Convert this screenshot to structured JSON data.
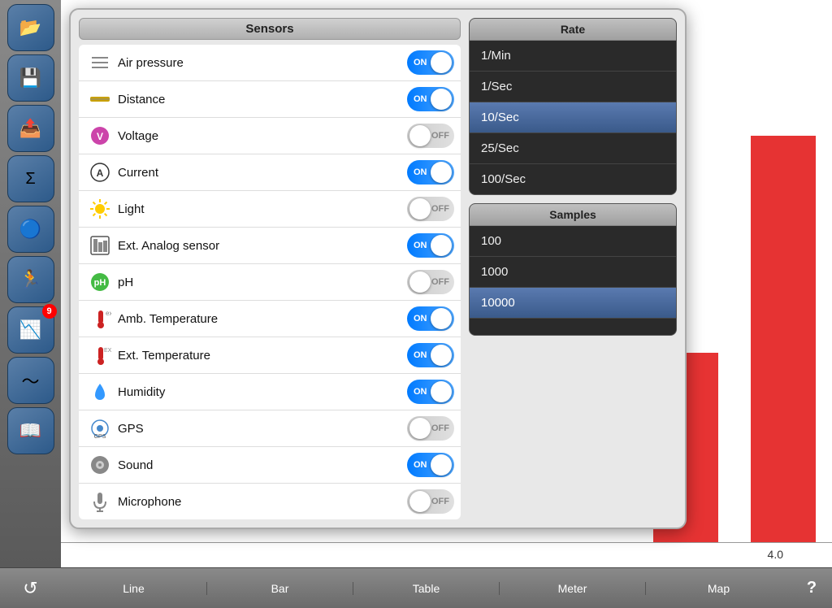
{
  "sidebar": {
    "buttons": [
      {
        "name": "folder-button",
        "icon": "📂",
        "label": "Folder"
      },
      {
        "name": "save-button",
        "icon": "💾",
        "label": "Save"
      },
      {
        "name": "share-button",
        "icon": "📤",
        "label": "Share"
      },
      {
        "name": "sigma-button",
        "icon": "Σ",
        "label": "Sigma"
      },
      {
        "name": "bluetooth-button",
        "icon": "🔵",
        "label": "Bluetooth"
      },
      {
        "name": "run-button",
        "icon": "🏃",
        "label": "Run"
      },
      {
        "name": "chart-button",
        "icon": "📉",
        "label": "Chart",
        "badge": "9"
      },
      {
        "name": "waveform-button",
        "icon": "〜",
        "label": "Waveform"
      },
      {
        "name": "book-button",
        "icon": "📖",
        "label": "Book"
      }
    ]
  },
  "sensors": {
    "header": "Sensors",
    "items": [
      {
        "name": "air-pressure",
        "label": "Air pressure",
        "icon": "♨",
        "state": "on"
      },
      {
        "name": "distance",
        "label": "Distance",
        "icon": "📏",
        "state": "on"
      },
      {
        "name": "voltage",
        "label": "Voltage",
        "icon": "🍇",
        "state": "off"
      },
      {
        "name": "current",
        "label": "Current",
        "icon": "🅐",
        "state": "on"
      },
      {
        "name": "light",
        "label": "Light",
        "icon": "☀",
        "state": "off"
      },
      {
        "name": "ext-analog",
        "label": "Ext. Analog sensor",
        "icon": "▦",
        "state": "on"
      },
      {
        "name": "ph",
        "label": "pH",
        "icon": "🅟",
        "state": "off"
      },
      {
        "name": "amb-temp",
        "label": "Amb. Temperature",
        "icon": "🌡",
        "state": "on"
      },
      {
        "name": "ext-temp",
        "label": "Ext. Temperature",
        "icon": "🌡",
        "state": "on"
      },
      {
        "name": "humidity",
        "label": "Humidity",
        "icon": "💧",
        "state": "on"
      },
      {
        "name": "gps",
        "label": "GPS",
        "icon": "📡",
        "state": "off"
      },
      {
        "name": "sound",
        "label": "Sound",
        "icon": "🎤",
        "state": "on"
      },
      {
        "name": "microphone",
        "label": "Microphone",
        "icon": "🎙",
        "state": "off"
      }
    ]
  },
  "rate": {
    "header": "Rate",
    "items": [
      {
        "label": "1/Min",
        "selected": false
      },
      {
        "label": "1/Sec",
        "selected": false
      },
      {
        "label": "10/Sec",
        "selected": true
      },
      {
        "label": "25/Sec",
        "selected": false
      },
      {
        "label": "100/Sec",
        "selected": false
      }
    ]
  },
  "samples": {
    "header": "Samples",
    "items": [
      {
        "label": "100",
        "selected": false
      },
      {
        "label": "1000",
        "selected": false
      },
      {
        "label": "10000",
        "selected": true
      },
      {
        "label": "",
        "selected": false
      }
    ]
  },
  "bottom": {
    "refresh_icon": "↺",
    "tabs": [
      "Line",
      "Bar",
      "Table",
      "Meter",
      "Map"
    ],
    "help": "?"
  },
  "chart": {
    "label": "4.0"
  }
}
